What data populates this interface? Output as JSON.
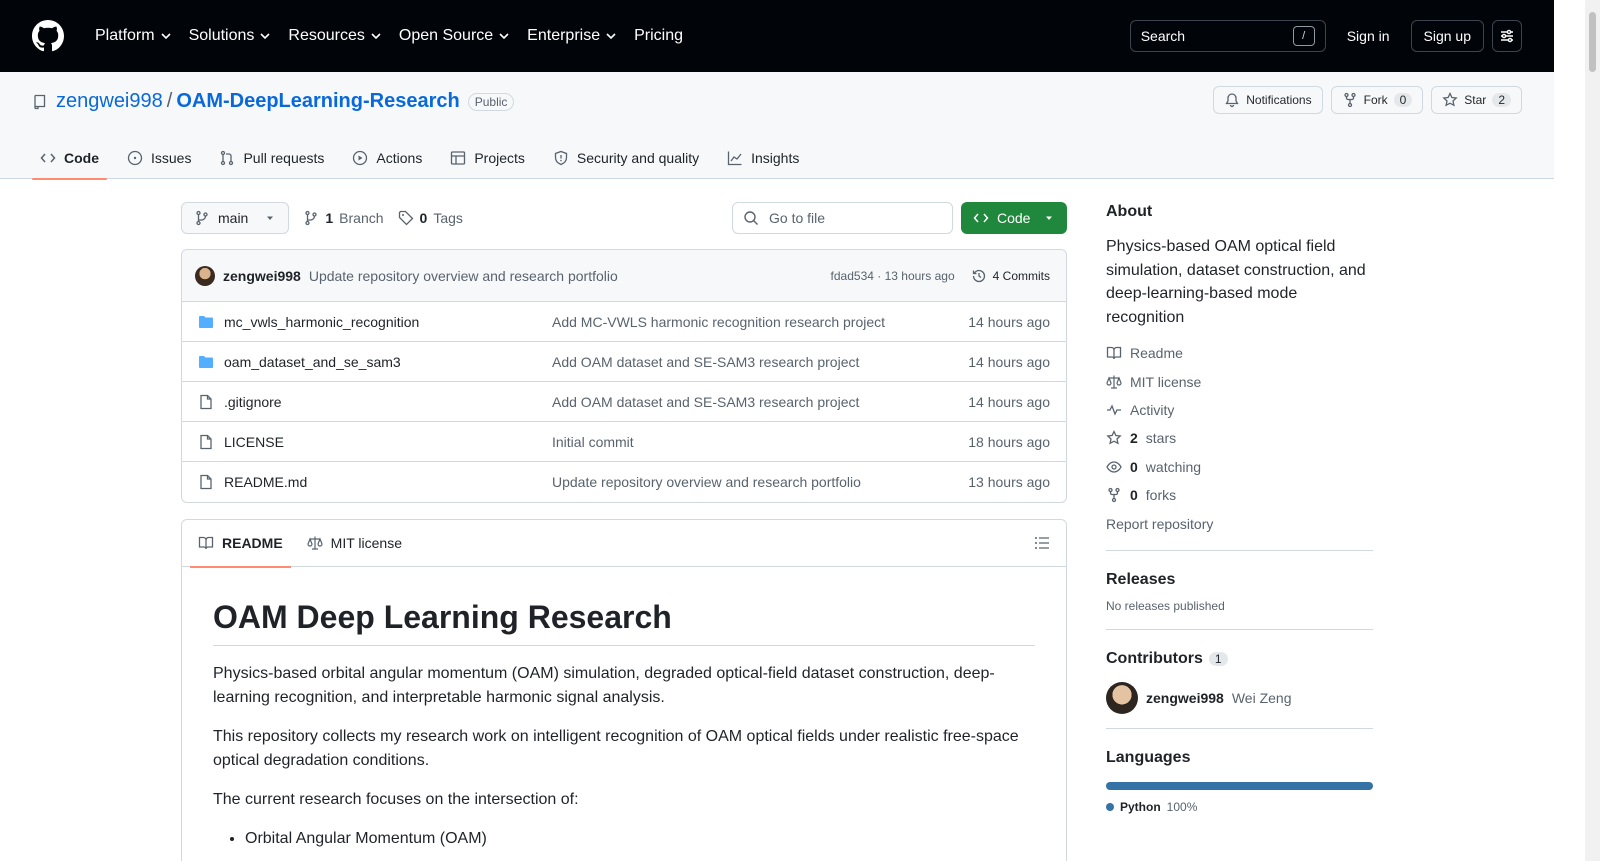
{
  "header": {
    "nav": [
      "Platform",
      "Solutions",
      "Resources",
      "Open Source",
      "Enterprise",
      "Pricing"
    ],
    "search_label": "Search",
    "search_key": "/",
    "sign_in": "Sign in",
    "sign_up": "Sign up"
  },
  "repo": {
    "owner": "zengwei998",
    "separator": "/",
    "name": "OAM-DeepLearning-Research",
    "visibility": "Public",
    "notifications": "Notifications",
    "fork_label": "Fork",
    "fork_count": "0",
    "star_label": "Star",
    "star_count": "2"
  },
  "tabs": [
    "Code",
    "Issues",
    "Pull requests",
    "Actions",
    "Projects",
    "Security and quality",
    "Insights"
  ],
  "toolbar": {
    "branch": "main",
    "branch_count": "1",
    "branch_label": "Branch",
    "tag_count": "0",
    "tag_label": "Tags",
    "goto_placeholder": "Go to file",
    "code_button": "Code"
  },
  "commit": {
    "author": "zengwei998",
    "message": "Update repository overview and research portfolio",
    "sha_time": "fdad534 · 13 hours ago",
    "commits": "4 Commits"
  },
  "files": [
    {
      "name": "mc_vwls_harmonic_recognition",
      "message": "Add MC-VWLS harmonic recognition research project",
      "time": "14 hours ago",
      "type": "folder"
    },
    {
      "name": "oam_dataset_and_se_sam3",
      "message": "Add OAM dataset and SE-SAM3 research project",
      "time": "14 hours ago",
      "type": "folder"
    },
    {
      "name": ".gitignore",
      "message": "Add OAM dataset and SE-SAM3 research project",
      "time": "14 hours ago",
      "type": "file"
    },
    {
      "name": "LICENSE",
      "message": "Initial commit",
      "time": "18 hours ago",
      "type": "file"
    },
    {
      "name": "README.md",
      "message": "Update repository overview and research portfolio",
      "time": "13 hours ago",
      "type": "file"
    }
  ],
  "readme": {
    "tab_readme": "README",
    "tab_license": "MIT license",
    "title": "OAM Deep Learning Research",
    "p1": "Physics-based orbital angular momentum (OAM) simulation, degraded optical-field dataset construction, deep-learning recognition, and interpretable harmonic signal analysis.",
    "p2": "This repository collects my research work on intelligent recognition of OAM optical fields under realistic free-space optical degradation conditions.",
    "p3": "The current research focuses on the intersection of:",
    "list": [
      "Orbital Angular Momentum (OAM)"
    ]
  },
  "sidebar": {
    "about_title": "About",
    "description": "Physics-based OAM optical field simulation, dataset construction, and deep-learning-based mode recognition",
    "readme": "Readme",
    "license": "MIT license",
    "activity": "Activity",
    "stars_count": "2",
    "stars_label": "stars",
    "watching_count": "0",
    "watching_label": "watching",
    "forks_count": "0",
    "forks_label": "forks",
    "report": "Report repository",
    "releases_title": "Releases",
    "releases_none": "No releases published",
    "contributors_title": "Contributors",
    "contributors_count": "1",
    "contributor_login": "zengwei998",
    "contributor_name": "Wei Zeng",
    "languages_title": "Languages",
    "language": "Python",
    "language_pct": "100%",
    "language_color": "#3572A5"
  }
}
